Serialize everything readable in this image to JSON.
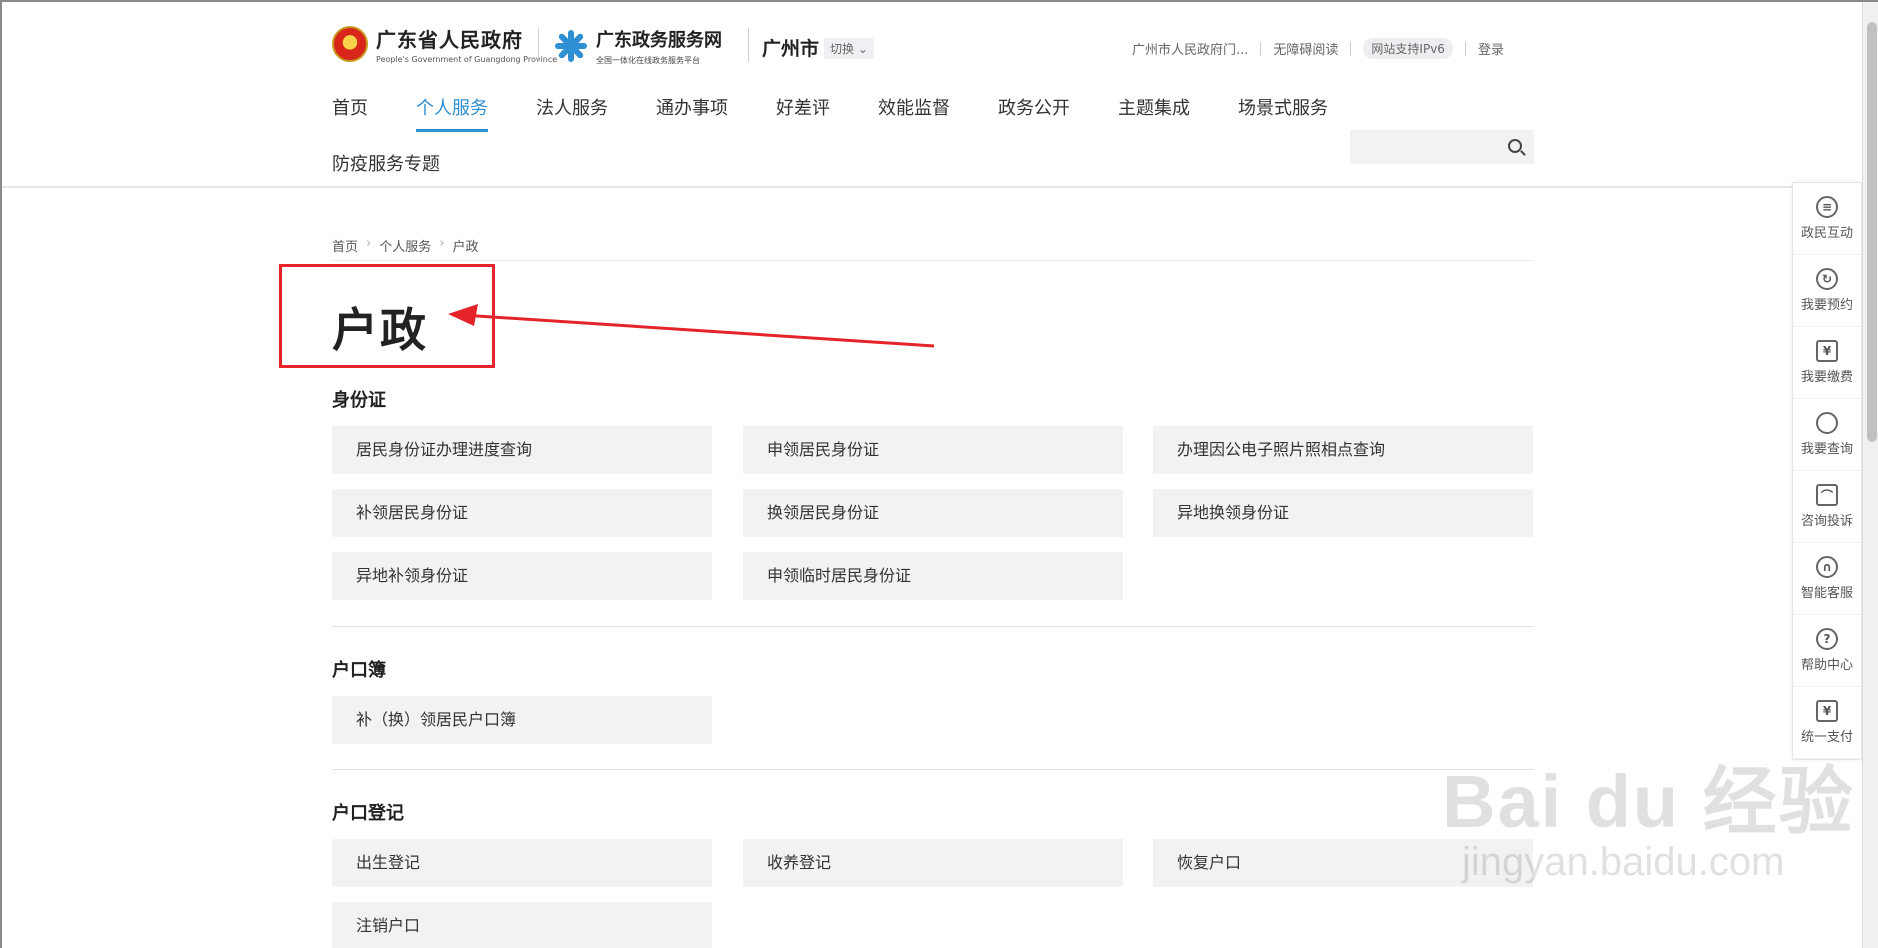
{
  "header": {
    "gov_name": "广东省人民政府",
    "gov_name_en": "People's Government of Guangdong Province",
    "service_name": "广东政务服务网",
    "service_sub": "全国一体化在线政务服务平台",
    "city": "广州市",
    "switch_label": "切换",
    "links": [
      "广州市人民政府门...",
      "无障碍阅读",
      "网站支持IPv6",
      "登录"
    ]
  },
  "nav": {
    "items": [
      "首页",
      "个人服务",
      "法人服务",
      "通办事项",
      "好差评",
      "效能监督",
      "政务公开",
      "主题集成",
      "场景式服务"
    ],
    "second_row": "防疫服务专题",
    "active_index": 1
  },
  "breadcrumb": [
    "首页",
    "个人服务",
    "户政"
  ],
  "page_title": "户政",
  "sections": [
    {
      "title": "身份证",
      "items": [
        "居民身份证办理进度查询",
        "申领居民身份证",
        "办理因公电子照片照相点查询",
        "补领居民身份证",
        "换领居民身份证",
        "异地换领身份证",
        "异地补领身份证",
        "申领临时居民身份证"
      ]
    },
    {
      "title": "户口簿",
      "items": [
        "补（换）领居民户口簿"
      ]
    },
    {
      "title": "户口登记",
      "items": [
        "出生登记",
        "收养登记",
        "恢复户口",
        "注销户口"
      ]
    }
  ],
  "sidebar": [
    {
      "label": "政民互动",
      "icon": "chat-icon"
    },
    {
      "label": "我要预约",
      "icon": "clock-icon"
    },
    {
      "label": "我要缴费",
      "icon": "yuan-icon"
    },
    {
      "label": "我要查询",
      "icon": "search-icon"
    },
    {
      "label": "咨询投诉",
      "icon": "screen-icon"
    },
    {
      "label": "智能客服",
      "icon": "headset-icon"
    },
    {
      "label": "帮助中心",
      "icon": "help-icon"
    },
    {
      "label": "统一支付",
      "icon": "yuan-icon"
    }
  ],
  "watermark": {
    "main": "Bai du 经验",
    "sub": "jingyan.baidu.com"
  },
  "colors": {
    "accent": "#2f8fd3",
    "highlight": "#e5232a"
  }
}
